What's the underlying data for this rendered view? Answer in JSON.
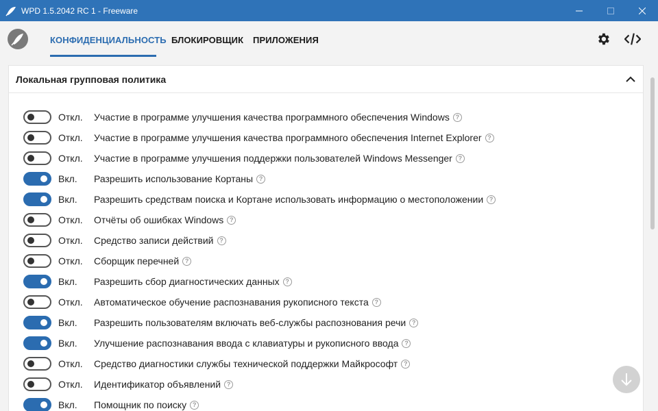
{
  "window": {
    "title": "WPD 1.5.2042 RC 1 - Freeware"
  },
  "colors": {
    "accent": "#2b6cb0",
    "titlebar": "#2f73b8"
  },
  "nav": {
    "tabs": [
      {
        "label": "КОНФИДЕНЦИАЛЬНОСТЬ",
        "active": true
      },
      {
        "label": "БЛОКИРОВЩИК",
        "active": false
      },
      {
        "label": "ПРИЛОЖЕНИЯ",
        "active": false
      }
    ],
    "icons": [
      "gear-icon",
      "code-icon"
    ]
  },
  "section": {
    "title": "Локальная групповая политика",
    "items": [
      {
        "state": "Откл.",
        "on": false,
        "label": "Участие в программе улучшения качества программного обеспечения Windows"
      },
      {
        "state": "Откл.",
        "on": false,
        "label": "Участие в программе улучшения качества программного обеспечения Internet Explorer"
      },
      {
        "state": "Откл.",
        "on": false,
        "label": "Участие в программе улучшения поддержки пользователей Windows Messenger"
      },
      {
        "state": "Вкл.",
        "on": true,
        "label": "Разрешить использование Кортаны"
      },
      {
        "state": "Вкл.",
        "on": true,
        "label": "Разрешить средствам поиска и Кортане использовать информацию о местоположении"
      },
      {
        "state": "Откл.",
        "on": false,
        "label": "Отчёты об ошибках Windows"
      },
      {
        "state": "Откл.",
        "on": false,
        "label": "Средство записи действий"
      },
      {
        "state": "Откл.",
        "on": false,
        "label": "Сборщик перечней"
      },
      {
        "state": "Вкл.",
        "on": true,
        "label": "Разрешить сбор диагностических данных"
      },
      {
        "state": "Откл.",
        "on": false,
        "label": "Автоматическое обучение распознавания рукописного текста"
      },
      {
        "state": "Вкл.",
        "on": true,
        "label": "Разрешить пользователям включать веб-службы распознования речи"
      },
      {
        "state": "Вкл.",
        "on": true,
        "label": "Улучшение распознавания ввода с клавиатуры и рукописного ввода"
      },
      {
        "state": "Откл.",
        "on": false,
        "label": "Средство диагностики службы технической поддержки Майкрософт"
      },
      {
        "state": "Откл.",
        "on": false,
        "label": "Идентификатор объявлений"
      },
      {
        "state": "Вкл.",
        "on": true,
        "label": "Помощник по поиску"
      }
    ]
  },
  "help_glyph": "?"
}
